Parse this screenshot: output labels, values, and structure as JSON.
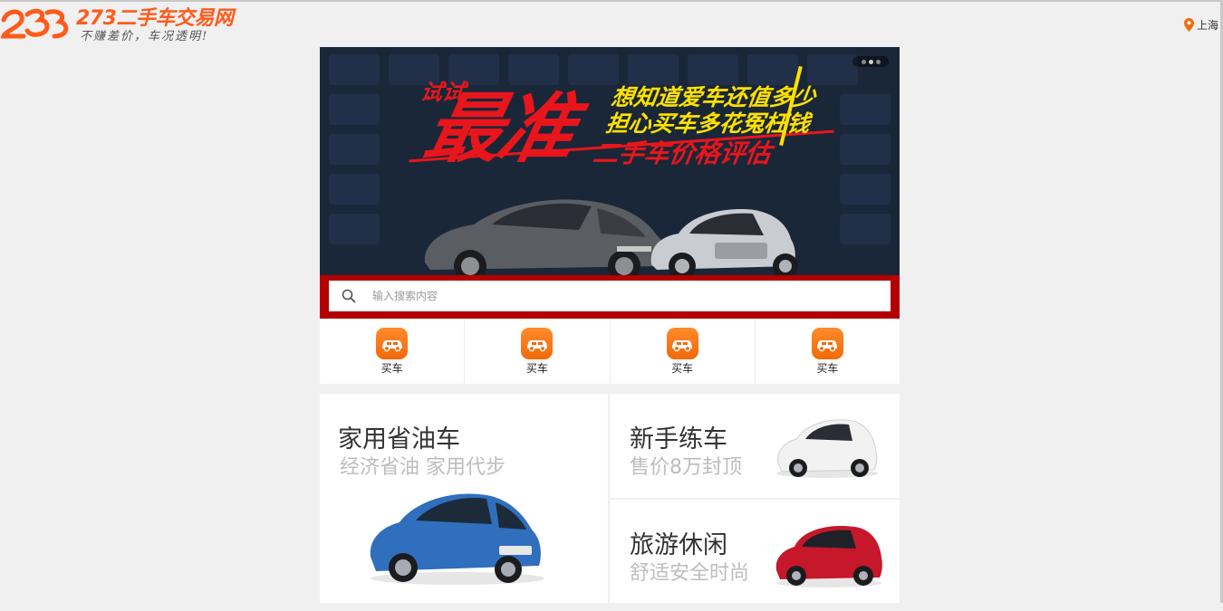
{
  "header": {
    "logo_title": "273二手车交易网",
    "logo_slogan": "不赚差价，车况透明!",
    "city": "上海",
    "location_icon": "map-pin-icon",
    "brand_color": "#ff5a1a"
  },
  "banner": {
    "try_text": "试试",
    "big_text": "最准",
    "line1": "想知道爱车还值多少",
    "line2": "担心买车多花冤枉钱",
    "line3": "二手车价格评估",
    "slide_count": 3,
    "active_slide": 1
  },
  "search": {
    "placeholder": "输入搜索内容",
    "icon": "search-icon"
  },
  "quicknav": [
    {
      "label": "买车",
      "icon": "car-icon"
    },
    {
      "label": "买车",
      "icon": "car-icon"
    },
    {
      "label": "买车",
      "icon": "car-icon"
    },
    {
      "label": "买车",
      "icon": "car-icon"
    }
  ],
  "promos": {
    "left": {
      "title": "家用省油车",
      "subtitle": "经济省油 家用代步"
    },
    "right_top": {
      "title": "新手练车",
      "subtitle": "售价8万封顶"
    },
    "right_bottom": {
      "title": "旅游休闲",
      "subtitle": "舒适安全时尚"
    }
  },
  "colors": {
    "accent": "#f26a0a",
    "search_frame": "#b30000",
    "banner_bg": "#182536",
    "banner_red": "#e8161c",
    "banner_yellow": "#ffe100"
  }
}
